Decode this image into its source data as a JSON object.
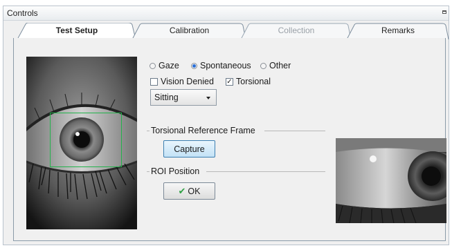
{
  "window": {
    "title": "Controls"
  },
  "tabs": [
    {
      "label": "Test Setup",
      "state": "active"
    },
    {
      "label": "Calibration",
      "state": "normal"
    },
    {
      "label": "Collection",
      "state": "disabled"
    },
    {
      "label": "Remarks",
      "state": "normal"
    }
  ],
  "mode": {
    "options": [
      "Gaze",
      "Spontaneous",
      "Other"
    ],
    "selected": "Spontaneous"
  },
  "checks": [
    {
      "label": "Vision Denied",
      "checked": false
    },
    {
      "label": "Torsional",
      "checked": true
    }
  ],
  "posture": {
    "value": "Sitting"
  },
  "torsional_frame": {
    "label": "Torsional Reference Frame",
    "button_label": "Capture"
  },
  "roi": {
    "label": "ROI Position",
    "button_label": "OK"
  },
  "colors": {
    "roi_box": "#21b34a",
    "radio_selected": "#2a6fd6",
    "ok_check": "#2ea043"
  },
  "icons": {
    "ok": "check-icon",
    "dropdown": "chevron-down-icon",
    "pin": "pin-icon"
  }
}
